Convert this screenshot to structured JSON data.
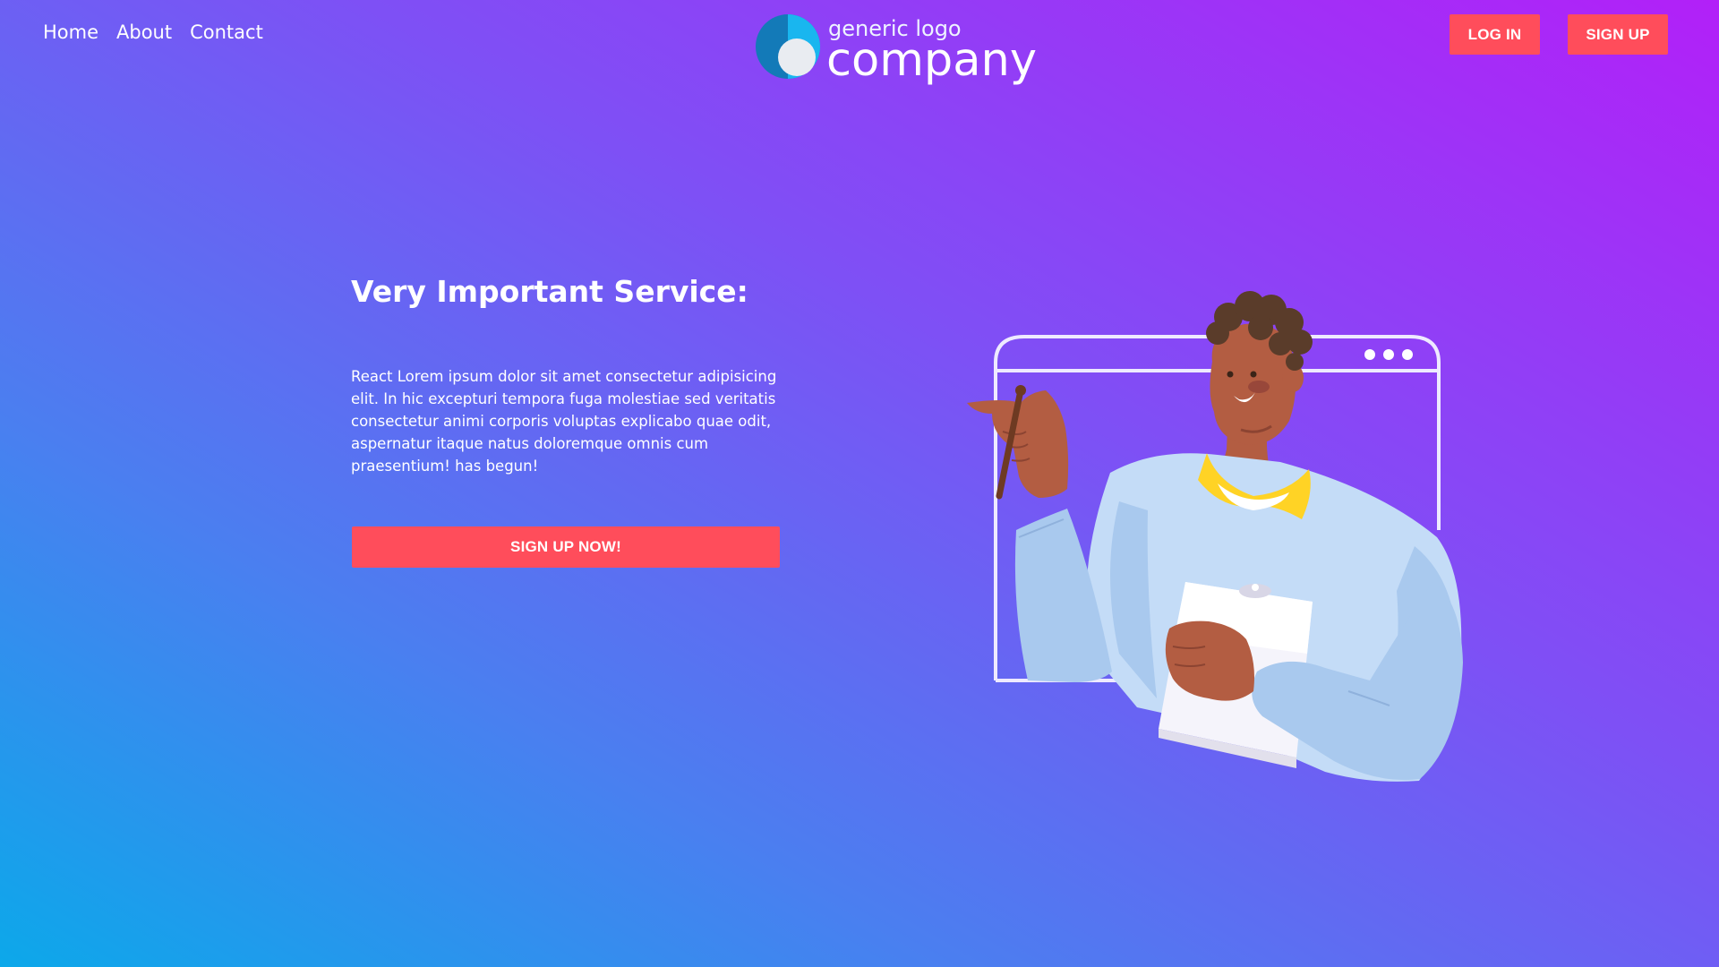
{
  "header": {
    "nav": [
      {
        "label": "Home"
      },
      {
        "label": "About"
      },
      {
        "label": "Contact"
      }
    ],
    "logo": {
      "small_text": "generic logo",
      "big_text": "company"
    },
    "login_label": "LOG IN",
    "signup_label": "SIGN UP"
  },
  "hero": {
    "title": "Very Important Service:",
    "description": "React Lorem ipsum dolor sit amet consectetur adipisicing elit. In hic excepturi tempora fuga molestiae sed veritatis consectetur animi corporis voluptas explicabo quae odit, aspernatur itaque natus doloremque omnis cum praesentium! has begun!",
    "cta_label": "SIGN UP NOW!"
  },
  "colors": {
    "accent": "#ff4d5b",
    "gradient_start": "#0ca8ea",
    "gradient_end": "#b220f8",
    "text": "#ffffff"
  },
  "icons": {
    "logo": "logo-circle-icon",
    "illustration": "person-pointing-with-pen-and-clipboard-in-browser-window"
  }
}
